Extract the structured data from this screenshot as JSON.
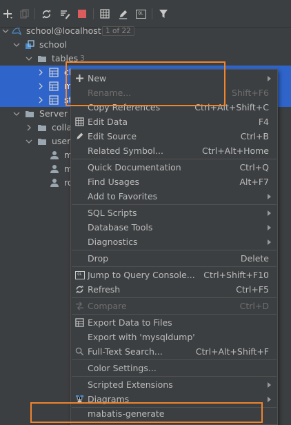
{
  "toolbar": {
    "icons": [
      "add-icon",
      "duplicate-icon",
      "refresh-icon",
      "properties-icon",
      "stop-icon",
      "table-icon",
      "edit-icon",
      "console-icon",
      "filter-icon"
    ]
  },
  "tree": {
    "connection": {
      "label": "school@localhost",
      "badge": "1 of 22"
    },
    "schema": {
      "label": "school"
    },
    "tables_group": {
      "label": "tables",
      "count": "3"
    },
    "tables": [
      {
        "label": "cl"
      },
      {
        "label": "m"
      },
      {
        "label": "st"
      }
    ],
    "server": {
      "label": "Server C"
    },
    "collations": {
      "label": "colla"
    },
    "users": {
      "label": "users"
    },
    "user_items": [
      {
        "label": "m"
      },
      {
        "label": "m"
      },
      {
        "label": "ro"
      }
    ]
  },
  "menu": {
    "new": "New",
    "rename": "Rename...",
    "rename_sc": "Shift+F6",
    "copy_refs": "Copy References",
    "copy_refs_sc": "Ctrl+Alt+Shift+C",
    "edit_data": "Edit Data",
    "edit_data_sc": "F4",
    "edit_source": "Edit Source",
    "edit_source_sc": "Ctrl+B",
    "related": "Related Symbol...",
    "related_sc": "Ctrl+Alt+Home",
    "quick_doc": "Quick Documentation",
    "quick_doc_sc": "Ctrl+Q",
    "find_usages": "Find Usages",
    "find_usages_sc": "Alt+F7",
    "favorites": "Add to Favorites",
    "sql_scripts": "SQL Scripts",
    "db_tools": "Database Tools",
    "diagnostics": "Diagnostics",
    "drop": "Drop",
    "drop_sc": "Delete",
    "jump_console": "Jump to Query Console...",
    "jump_console_sc": "Ctrl+Shift+F10",
    "refresh": "Refresh",
    "refresh_sc": "Ctrl+F5",
    "compare": "Compare",
    "compare_sc": "Ctrl+D",
    "export_files": "Export Data to Files",
    "export_dump": "Export with 'mysqldump'",
    "fulltext": "Full-Text Search...",
    "fulltext_sc": "Ctrl+Alt+Shift+F",
    "color_settings": "Color Settings...",
    "scripted_ext": "Scripted Extensions",
    "diagrams": "Diagrams",
    "mabatis": "mabatis-generate"
  },
  "colors": {
    "background": "#3c3f41",
    "selection": "#2f65ca",
    "highlight": "#f0852d",
    "text": "#bbbbbb",
    "disabled": "#6e6e6e"
  }
}
